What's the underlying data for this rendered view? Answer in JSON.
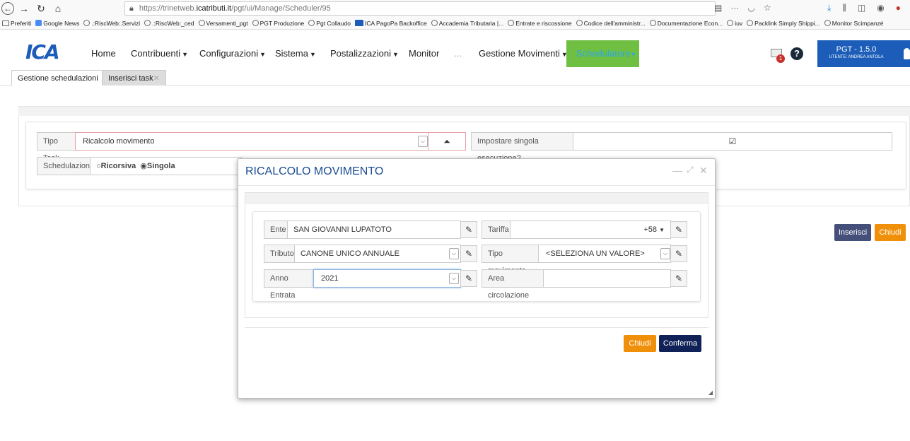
{
  "browser": {
    "url_prefix": "https://trinetweb.",
    "url_host": "icatributi.it",
    "url_path": "/pgt/ui/Manage/Scheduler/95"
  },
  "bookmarks": [
    {
      "label": "Preferiti",
      "icon": "folder-icon"
    },
    {
      "label": "Google News",
      "icon": "google-news-icon"
    },
    {
      "label": ".:RiscWeb:.Servizi",
      "icon": "globe-icon"
    },
    {
      "label": ".:RiscWeb:_ced",
      "icon": "globe-icon"
    },
    {
      "label": "Versamenti_pgt",
      "icon": "globe-icon"
    },
    {
      "label": "PGT Produzione",
      "icon": "globe-icon"
    },
    {
      "label": "Pgt Collaudo",
      "icon": "globe-icon"
    },
    {
      "label": "ICA PagoPa Backoffice",
      "icon": "ica-icon"
    },
    {
      "label": "Accademia Tributaria |...",
      "icon": "globe-icon"
    },
    {
      "label": "Entrate e riscossione",
      "icon": "globe-icon"
    },
    {
      "label": "Codice dell'amministr...",
      "icon": "globe-icon"
    },
    {
      "label": "Documentazione Econ...",
      "icon": "globe-icon"
    },
    {
      "label": "iuv",
      "icon": "globe-icon"
    },
    {
      "label": "Packlink Simply Shippi...",
      "icon": "globe-icon"
    },
    {
      "label": "Monitor Scimpanzé",
      "icon": "globe-icon"
    }
  ],
  "app": {
    "logo": "ICA",
    "menu": {
      "home": "Home",
      "contribuenti": "Contribuenti",
      "configurazioni": "Configurazioni",
      "sistema": "Sistema",
      "postalizzazioni": "Postalizzazioni",
      "monitor": "Monitor",
      "more": "...",
      "gestione_movimenti": "Gestione Movimenti",
      "schedulatore": "Schedulatore"
    },
    "notification_count": "1",
    "help": "?",
    "version": "PGT - 1.5.0",
    "user": "UTENTE: ANDREA ANTOLA",
    "colors": {
      "accent_green": "#6fbf43",
      "brand_blue": "#1b5db8",
      "orange": "#f0900a",
      "navy": "#0f2156"
    }
  },
  "tabs": [
    {
      "label": "Gestione schedulazioni"
    },
    {
      "label": "Inserisci task"
    }
  ],
  "form": {
    "tipo_task_label": "Tipo Task",
    "tipo_task_value": "Ricalcolo movimento",
    "singola_label": "Impostare singola esecuzione?",
    "singola_checked": "☑",
    "schedulazione_label": "Schedulazione",
    "radio_ricorsiva": "Ricorsiva",
    "radio_singola": "Singola",
    "selected_radio": "Singola"
  },
  "actions": {
    "inserisci": "Inserisci",
    "chiudi": "Chiudi"
  },
  "modal": {
    "title": "RICALCOLO MOVIMENTO",
    "ente_label": "Ente",
    "ente_value": "SAN GIOVANNI LUPATOTO",
    "tariffa_label": "Tariffa",
    "tariffa_value": "+58",
    "tributo_label": "Tributo",
    "tributo_value": "CANONE UNICO ANNUALE",
    "tipo_movimento_label": "Tipo movimento",
    "tipo_movimento_value": "<SELEZIONA UN VALORE>",
    "anno_entrata_label": "Anno Entrata",
    "anno_entrata_value": "2021",
    "area_circolazione_label": "Area circolazione",
    "area_circolazione_value": "",
    "chiudi": "Chiudi",
    "conferma": "Conferma"
  }
}
